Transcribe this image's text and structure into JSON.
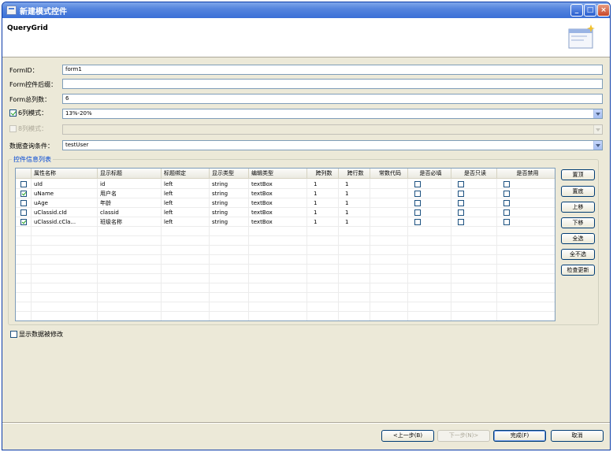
{
  "window": {
    "title": "新建模式控件"
  },
  "header": {
    "title": "QueryGrid"
  },
  "form": {
    "form_id_label": "FormID：",
    "form_id_value": "form1",
    "suffix_label": "Form控件后缀：",
    "suffix_value": "",
    "columns_label": "Form总列数：",
    "columns_value": "6",
    "six_col_label": "6列模式：",
    "six_col_value": "13%-20%",
    "eight_col_label": "8列模式：",
    "eight_col_value": "",
    "query_label": "数据查询条件：",
    "query_value": "testUser"
  },
  "group": {
    "title": "控件信息列表"
  },
  "grid": {
    "columns": [
      "属性名称",
      "显示标题",
      "标题绑定",
      "显示类型",
      "编辑类型",
      "跨列数",
      "跨行数",
      "常数代码",
      "是否必填",
      "是否只读",
      "是否禁用"
    ],
    "rows": [
      {
        "checked": false,
        "name": "uId",
        "title": "id",
        "align": "left",
        "type": "string",
        "edit": "textBox",
        "colspan": "1",
        "rowspan": "1"
      },
      {
        "checked": true,
        "name": "uName",
        "title": "用户名",
        "align": "left",
        "type": "string",
        "edit": "textBox",
        "colspan": "1",
        "rowspan": "1"
      },
      {
        "checked": false,
        "name": "uAge",
        "title": "年龄",
        "align": "left",
        "type": "string",
        "edit": "textBox",
        "colspan": "1",
        "rowspan": "1"
      },
      {
        "checked": false,
        "name": "uClassid.cId",
        "title": "classid",
        "align": "left",
        "type": "string",
        "edit": "textBox",
        "colspan": "1",
        "rowspan": "1"
      },
      {
        "checked": true,
        "name": "uClassid.cCla...",
        "title": "班级名称",
        "align": "left",
        "type": "string",
        "edit": "textBox",
        "colspan": "1",
        "rowspan": "1"
      }
    ]
  },
  "side_buttons": [
    "置顶",
    "置底",
    "上移",
    "下移",
    "全选",
    "全不选",
    "检查更新"
  ],
  "bottom": {
    "show_modified_label": "显示数据被修改"
  },
  "footer": {
    "back": "<上一步(B)",
    "next": "下一步(N)>",
    "finish": "完成(F)",
    "cancel": "取消"
  }
}
